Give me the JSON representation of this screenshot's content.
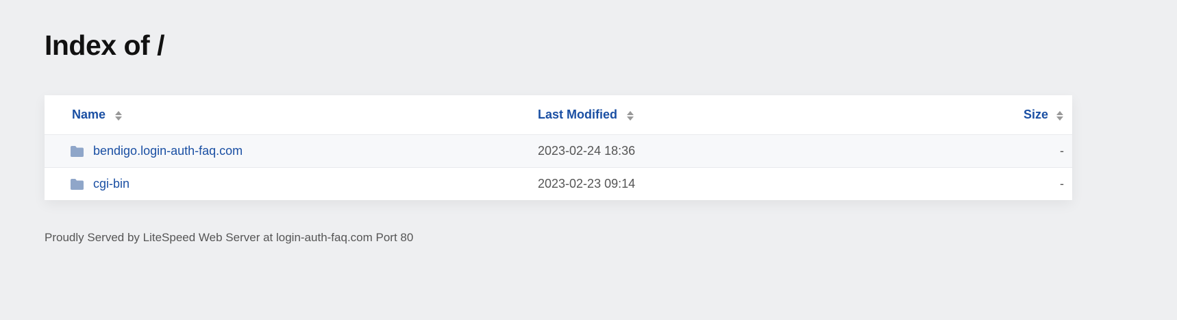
{
  "page": {
    "title": "Index of /"
  },
  "table": {
    "headers": {
      "name": "Name",
      "modified": "Last Modified",
      "size": "Size"
    },
    "rows": [
      {
        "name": "bendigo.login-auth-faq.com",
        "modified": "2023-02-24 18:36",
        "size": "-",
        "icon": "folder-icon"
      },
      {
        "name": "cgi-bin",
        "modified": "2023-02-23 09:14",
        "size": "-",
        "icon": "folder-icon"
      }
    ]
  },
  "footer": {
    "text": "Proudly Served by LiteSpeed Web Server at login-auth-faq.com Port 80"
  },
  "colors": {
    "link": "#1a4fa3",
    "background": "#eeeff1",
    "folder": "#8fa6c9"
  }
}
